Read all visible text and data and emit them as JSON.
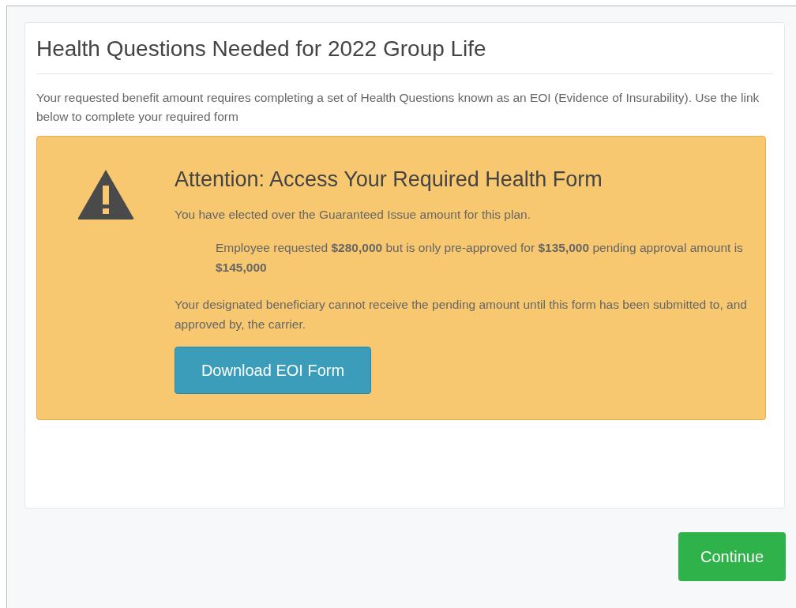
{
  "card": {
    "title": "Health Questions Needed for 2022 Group Life",
    "intro": "Your requested benefit amount requires completing a set of Health Questions known as an EOI (Evidence of Insurability). Use the link below to complete your required form"
  },
  "alert": {
    "title": "Attention: Access Your Required Health Form",
    "line": "You have elected over the Guaranteed Issue amount for this plan.",
    "detail": "Employee requested **$280,000** but is only pre-approved for **$135,000** pending approval amount is **$145,000**",
    "note": "Your designated beneficiary cannot receive the pending amount until this form has been submitted to, and approved by, the carrier.",
    "button": "Download EOI Form"
  },
  "footer": {
    "button": "Continue"
  }
}
